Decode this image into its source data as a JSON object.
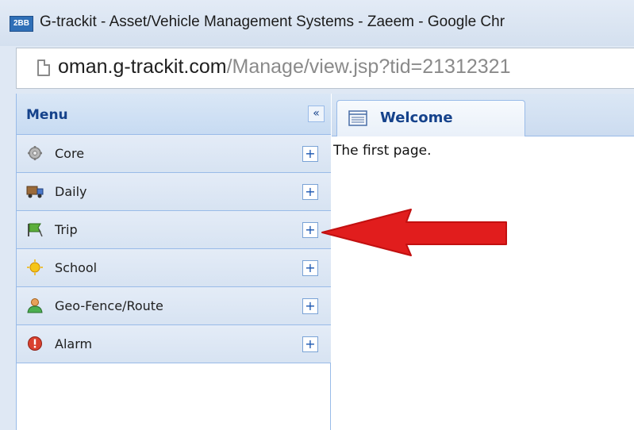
{
  "window": {
    "app_icon_text": "2BB",
    "title": "G-trackit - Asset/Vehicle Management Systems - Zaeem - Google Chr"
  },
  "address_bar": {
    "url_domain": "oman.g-trackit.com",
    "url_path": "/Manage/view.jsp?tid=21312321"
  },
  "menu": {
    "title": "Menu",
    "collapse_glyph": "«",
    "expand_glyph": "+",
    "items": [
      {
        "label": "Core",
        "icon": "gear-icon"
      },
      {
        "label": "Daily",
        "icon": "truck-icon"
      },
      {
        "label": "Trip",
        "icon": "flag-icon"
      },
      {
        "label": "School",
        "icon": "sun-icon"
      },
      {
        "label": "Geo-Fence/Route",
        "icon": "person-icon"
      },
      {
        "label": "Alarm",
        "icon": "alert-icon"
      }
    ]
  },
  "tabs": [
    {
      "label": "Welcome",
      "icon": "page-icon"
    }
  ],
  "content": {
    "text": "The first page."
  },
  "annotation": {
    "arrow_color": "#e11d1d",
    "points_to": "Trip"
  }
}
